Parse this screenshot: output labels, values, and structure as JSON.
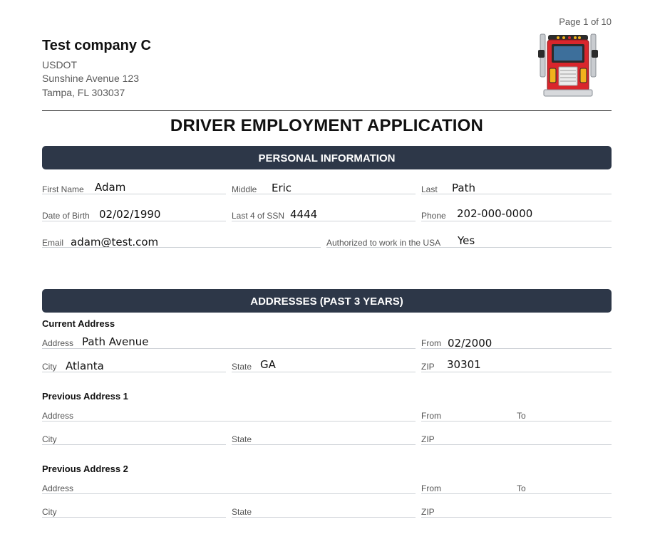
{
  "page": {
    "number_text": "Page 1 of 10"
  },
  "company": {
    "name": "Test company C",
    "usdot": "USDOT",
    "street": "Sunshine Avenue 123",
    "city_state_zip": "Tampa, FL 303037",
    "logo_icon": "truck-front-icon"
  },
  "title": "DRIVER EMPLOYMENT APPLICATION",
  "personal": {
    "header": "PERSONAL INFORMATION",
    "first_name": {
      "label": "First Name",
      "value": "Adam"
    },
    "middle": {
      "label": "Middle",
      "value": "Eric"
    },
    "last": {
      "label": "Last",
      "value": "Path"
    },
    "dob": {
      "label": "Date of Birth",
      "value": "02/02/1990"
    },
    "ssn": {
      "label": "Last 4 of SSN",
      "value": "4444"
    },
    "phone": {
      "label": "Phone",
      "value": "202-000-0000"
    },
    "email": {
      "label": "Email",
      "value": "adam@test.com"
    },
    "authorized": {
      "label": "Authorized to work in the USA",
      "value": "Yes"
    }
  },
  "addresses": {
    "header": "ADDRESSES (PAST 3 YEARS)",
    "current": {
      "title": "Current Address",
      "address": {
        "label": "Address",
        "value": "Path Avenue"
      },
      "from": {
        "label": "From",
        "value": "02/2000"
      },
      "city": {
        "label": "City",
        "value": "Atlanta"
      },
      "state": {
        "label": "State",
        "value": "GA"
      },
      "zip": {
        "label": "ZIP",
        "value": "30301"
      }
    },
    "previous1": {
      "title": "Previous Address 1",
      "address_label": "Address",
      "from_label": "From",
      "to_label": "To",
      "city_label": "City",
      "state_label": "State",
      "zip_label": "ZIP"
    },
    "previous2": {
      "title": "Previous Address 2",
      "address_label": "Address",
      "from_label": "From",
      "to_label": "To",
      "city_label": "City",
      "state_label": "State",
      "zip_label": "ZIP"
    }
  },
  "colors": {
    "banner": "#2d3748",
    "field_line": "#cfd3d8",
    "truck_red": "#d9262c",
    "truck_window": "#3d6f9b"
  }
}
